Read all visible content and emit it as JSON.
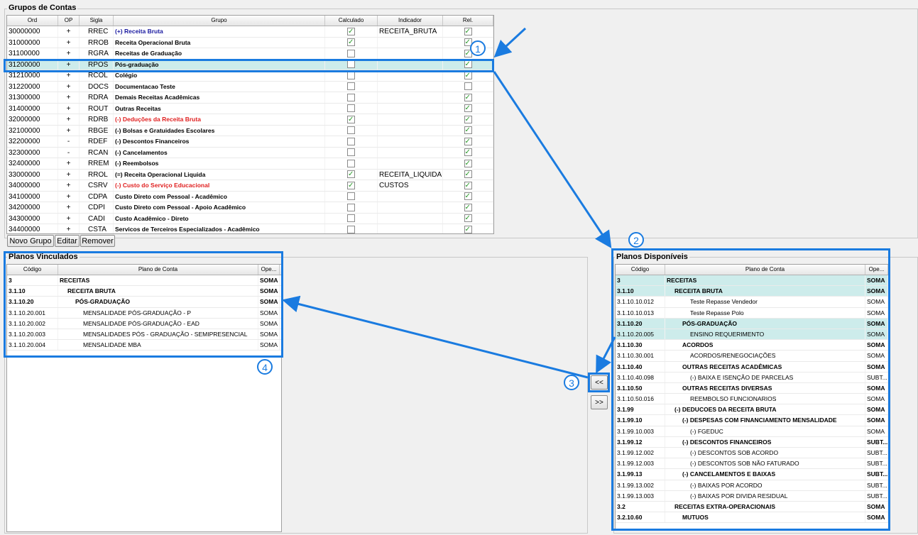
{
  "grupos": {
    "title": "Grupos de Contas",
    "columns": [
      "Ord",
      "OP",
      "Sigla",
      "Grupo",
      "Calculado",
      "Indicador",
      "Rel."
    ],
    "rows": [
      {
        "ord": "30000000",
        "op": "+",
        "sigla": "RREC",
        "grupo": "(+) Receita Bruta",
        "calc": true,
        "ind": "RECEITA_BRUTA",
        "rel": true,
        "color": "#1a1aa0"
      },
      {
        "ord": "31000000",
        "op": "+",
        "sigla": "RROB",
        "grupo": "Receita Operacional Bruta",
        "calc": true,
        "ind": "",
        "rel": true,
        "color": "#000000"
      },
      {
        "ord": "31100000",
        "op": "+",
        "sigla": "RGRA",
        "grupo": "Receitas de Graduação",
        "calc": false,
        "ind": "",
        "rel": true,
        "color": "#000000"
      },
      {
        "ord": "31200000",
        "op": "+",
        "sigla": "RPOS",
        "grupo": "Pós-graduação",
        "calc": false,
        "ind": "",
        "rel": true,
        "color": "#000000"
      },
      {
        "ord": "31210000",
        "op": "+",
        "sigla": "RCOL",
        "grupo": "Colégio",
        "calc": false,
        "ind": "",
        "rel": true,
        "color": "#000000"
      },
      {
        "ord": "31220000",
        "op": "+",
        "sigla": "DOCS",
        "grupo": "Documentacao Teste",
        "calc": false,
        "ind": "",
        "rel": false,
        "color": "#000000"
      },
      {
        "ord": "31300000",
        "op": "+",
        "sigla": "RDRA",
        "grupo": "Demais Receitas Acadêmicas",
        "calc": false,
        "ind": "",
        "rel": true,
        "color": "#000000"
      },
      {
        "ord": "31400000",
        "op": "+",
        "sigla": "ROUT",
        "grupo": "Outras Receitas",
        "calc": false,
        "ind": "",
        "rel": true,
        "color": "#000000"
      },
      {
        "ord": "32000000",
        "op": "+",
        "sigla": "RDRB",
        "grupo": "(-) Deduções da Receita Bruta",
        "calc": true,
        "ind": "",
        "rel": true,
        "color": "#e02020"
      },
      {
        "ord": "32100000",
        "op": "+",
        "sigla": "RBGE",
        "grupo": "(-) Bolsas e Gratuidades Escolares",
        "calc": false,
        "ind": "",
        "rel": true,
        "color": "#000000"
      },
      {
        "ord": "32200000",
        "op": "-",
        "sigla": "RDEF",
        "grupo": "(-) Descontos Financeiros",
        "calc": false,
        "ind": "",
        "rel": true,
        "color": "#000000"
      },
      {
        "ord": "32300000",
        "op": "-",
        "sigla": "RCAN",
        "grupo": "(-) Cancelamentos",
        "calc": false,
        "ind": "",
        "rel": true,
        "color": "#000000"
      },
      {
        "ord": "32400000",
        "op": "+",
        "sigla": "RREM",
        "grupo": "(-) Reembolsos",
        "calc": false,
        "ind": "",
        "rel": true,
        "color": "#000000"
      },
      {
        "ord": "33000000",
        "op": "+",
        "sigla": "RROL",
        "grupo": "(=) Receita Operacional Liquida",
        "calc": true,
        "ind": "RECEITA_LIQUIDA",
        "rel": true,
        "color": "#000000"
      },
      {
        "ord": "34000000",
        "op": "+",
        "sigla": "CSRV",
        "grupo": "(-) Custo do Serviço Educacional",
        "calc": true,
        "ind": "CUSTOS",
        "rel": true,
        "color": "#e02020"
      },
      {
        "ord": "34100000",
        "op": "+",
        "sigla": "CDPA",
        "grupo": "Custo Direto com Pessoal - Acadêmico",
        "calc": false,
        "ind": "",
        "rel": true,
        "color": "#000000"
      },
      {
        "ord": "34200000",
        "op": "+",
        "sigla": "CDPI",
        "grupo": "Custo Direto com Pessoal - Apoio Acadêmico",
        "calc": false,
        "ind": "",
        "rel": true,
        "color": "#000000"
      },
      {
        "ord": "34300000",
        "op": "+",
        "sigla": "CADI",
        "grupo": "Custo Acadêmico - Direto",
        "calc": false,
        "ind": "",
        "rel": true,
        "color": "#000000"
      },
      {
        "ord": "34400000",
        "op": "+",
        "sigla": "CSTA",
        "grupo": "Servicos de Terceiros Especializados - Acadêmico",
        "calc": false,
        "ind": "",
        "rel": true,
        "color": "#000000"
      }
    ],
    "selected_index": 3
  },
  "buttons": {
    "novo": "Novo Grupo",
    "editar": "Editar",
    "remover": "Remover",
    "add": "<<",
    "remove": ">>"
  },
  "vinculados": {
    "title": "Planos Vinculados",
    "columns": [
      "Código",
      "Plano de Conta",
      "Ope..."
    ],
    "rows": [
      {
        "cod": "3",
        "plano": "RECEITAS",
        "ope": "SOMA",
        "bold": true,
        "indent": 0
      },
      {
        "cod": "3.1.10",
        "plano": "RECEITA BRUTA",
        "ope": "SOMA",
        "bold": true,
        "indent": 1
      },
      {
        "cod": "3.1.10.20",
        "plano": "PÓS-GRADUAÇÃO",
        "ope": "SOMA",
        "bold": true,
        "indent": 2
      },
      {
        "cod": "3.1.10.20.001",
        "plano": "MENSALIDADE PÓS-GRADUAÇÃO - P",
        "ope": "SOMA",
        "bold": false,
        "indent": 3
      },
      {
        "cod": "3.1.10.20.002",
        "plano": "MENSALIDADE PÓS-GRADUAÇÃO - EAD",
        "ope": "SOMA",
        "bold": false,
        "indent": 3
      },
      {
        "cod": "3.1.10.20.003",
        "plano": "MENSALIDADES PÓS - GRADUAÇÃO - SEMIPRESENCIAL",
        "ope": "SOMA",
        "bold": false,
        "indent": 3
      },
      {
        "cod": "3.1.10.20.004",
        "plano": "MENSALIDADE MBA",
        "ope": "SOMA",
        "bold": false,
        "indent": 3
      }
    ]
  },
  "disponiveis": {
    "title": "Planos Disponíveis",
    "columns": [
      "Código",
      "Plano de Conta",
      "Ope..."
    ],
    "rows": [
      {
        "cod": "3",
        "plano": "RECEITAS",
        "ope": "SOMA",
        "bold": true,
        "indent": 0,
        "hl": true
      },
      {
        "cod": "3.1.10",
        "plano": "RECEITA BRUTA",
        "ope": "SOMA",
        "bold": true,
        "indent": 1,
        "hl": true
      },
      {
        "cod": "3.1.10.10.012",
        "plano": "Teste Repasse Vendedor",
        "ope": "SOMA",
        "bold": false,
        "indent": 3,
        "hl": false
      },
      {
        "cod": "3.1.10.10.013",
        "plano": "Teste Repasse Polo",
        "ope": "SOMA",
        "bold": false,
        "indent": 3,
        "hl": false
      },
      {
        "cod": "3.1.10.20",
        "plano": "PÓS-GRADUAÇÃO",
        "ope": "SOMA",
        "bold": true,
        "indent": 2,
        "hl": true
      },
      {
        "cod": "3.1.10.20.005",
        "plano": "ENSINO REQUERIMENTO",
        "ope": "SOMA",
        "bold": false,
        "indent": 3,
        "hl": true
      },
      {
        "cod": "3.1.10.30",
        "plano": "ACORDOS",
        "ope": "SOMA",
        "bold": true,
        "indent": 2,
        "hl": false
      },
      {
        "cod": "3.1.10.30.001",
        "plano": "ACORDOS/RENEGOCIAÇÕES",
        "ope": "SOMA",
        "bold": false,
        "indent": 3,
        "hl": false
      },
      {
        "cod": "3.1.10.40",
        "plano": "OUTRAS RECEITAS ACADÊMICAS",
        "ope": "SOMA",
        "bold": true,
        "indent": 2,
        "hl": false
      },
      {
        "cod": "3.1.10.40.098",
        "plano": "(-) BAIXA E ISENÇÃO DE PARCELAS",
        "ope": "SUBT...",
        "bold": false,
        "indent": 3,
        "hl": false
      },
      {
        "cod": "3.1.10.50",
        "plano": "OUTRAS RECEITAS DIVERSAS",
        "ope": "SOMA",
        "bold": true,
        "indent": 2,
        "hl": false
      },
      {
        "cod": "3.1.10.50.016",
        "plano": "REEMBOLSO FUNCIONARIOS",
        "ope": "SOMA",
        "bold": false,
        "indent": 3,
        "hl": false
      },
      {
        "cod": "3.1.99",
        "plano": "(-) DEDUCOES DA RECEITA BRUTA",
        "ope": "SOMA",
        "bold": true,
        "indent": 1,
        "hl": false
      },
      {
        "cod": "3.1.99.10",
        "plano": "(-) DESPESAS COM FINANCIAMENTO MENSALIDADE",
        "ope": "SOMA",
        "bold": true,
        "indent": 2,
        "hl": false
      },
      {
        "cod": "3.1.99.10.003",
        "plano": "(-) FGEDUC",
        "ope": "SOMA",
        "bold": false,
        "indent": 3,
        "hl": false
      },
      {
        "cod": "3.1.99.12",
        "plano": "(-) DESCONTOS FINANCEIROS",
        "ope": "SUBT...",
        "bold": true,
        "indent": 2,
        "hl": false
      },
      {
        "cod": "3.1.99.12.002",
        "plano": "(-) DESCONTOS SOB ACORDO",
        "ope": "SUBT...",
        "bold": false,
        "indent": 3,
        "hl": false
      },
      {
        "cod": "3.1.99.12.003",
        "plano": "(-) DESCONTOS SOB NÃO FATURADO",
        "ope": "SUBT...",
        "bold": false,
        "indent": 3,
        "hl": false
      },
      {
        "cod": "3.1.99.13",
        "plano": "(-) CANCELAMENTOS E BAIXAS",
        "ope": "SUBT...",
        "bold": true,
        "indent": 2,
        "hl": false
      },
      {
        "cod": "3.1.99.13.002",
        "plano": "(-) BAIXAS POR ACORDO",
        "ope": "SUBT...",
        "bold": false,
        "indent": 3,
        "hl": false
      },
      {
        "cod": "3.1.99.13.003",
        "plano": "(-) BAIXAS POR DIVIDA RESIDUAL",
        "ope": "SUBT...",
        "bold": false,
        "indent": 3,
        "hl": false
      },
      {
        "cod": "3.2",
        "plano": "RECEITAS EXTRA-OPERACIONAIS",
        "ope": "SOMA",
        "bold": true,
        "indent": 1,
        "hl": false
      },
      {
        "cod": "3.2.10.60",
        "plano": "MUTUOS",
        "ope": "SOMA",
        "bold": true,
        "indent": 2,
        "hl": false
      }
    ]
  },
  "callouts": [
    "1",
    "2",
    "3",
    "4"
  ],
  "accent": "#1a7be0"
}
